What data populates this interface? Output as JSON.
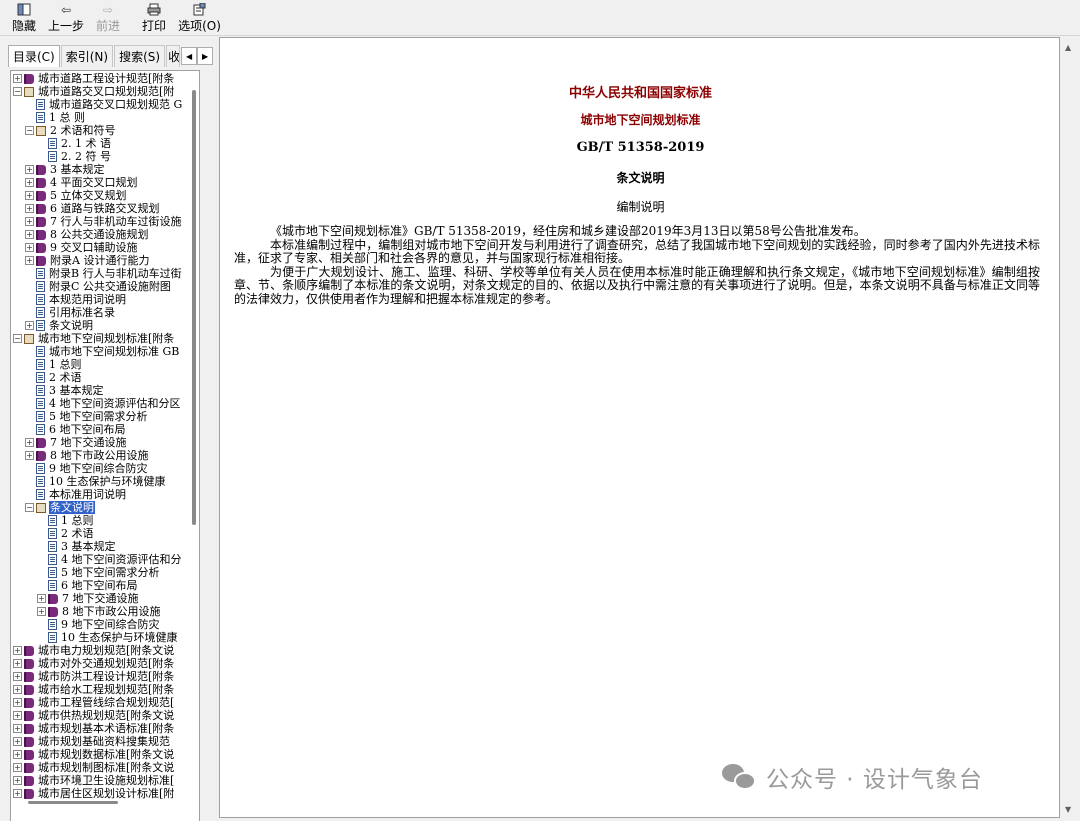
{
  "toolbar": {
    "hide": "隐藏",
    "back": "上一步",
    "forward": "前进",
    "print": "打印",
    "options": "选项(O)"
  },
  "tabs": [
    "目录(C)",
    "索引(N)",
    "搜索(S)",
    "收"
  ],
  "tree": [
    {
      "level": 0,
      "exp": "+",
      "icon": "book-closed",
      "label": "城市道路工程设计规范[附条"
    },
    {
      "level": 0,
      "exp": "-",
      "icon": "book-open",
      "label": "城市道路交叉口规划规范[附"
    },
    {
      "level": 1,
      "exp": "",
      "icon": "page",
      "label": "城市道路交叉口规划规范 G"
    },
    {
      "level": 1,
      "exp": "",
      "icon": "page",
      "label": "1 总 则"
    },
    {
      "level": 1,
      "exp": "-",
      "icon": "book-open",
      "label": "2 术语和符号"
    },
    {
      "level": 2,
      "exp": "",
      "icon": "page",
      "label": "2. 1 术 语"
    },
    {
      "level": 2,
      "exp": "",
      "icon": "page",
      "label": "2. 2 符 号"
    },
    {
      "level": 1,
      "exp": "+",
      "icon": "book-closed",
      "label": "3 基本规定"
    },
    {
      "level": 1,
      "exp": "+",
      "icon": "book-closed",
      "label": "4 平面交叉口规划"
    },
    {
      "level": 1,
      "exp": "+",
      "icon": "book-closed",
      "label": "5 立体交叉规划"
    },
    {
      "level": 1,
      "exp": "+",
      "icon": "book-closed",
      "label": "6 道路与铁路交叉规划"
    },
    {
      "level": 1,
      "exp": "+",
      "icon": "book-closed",
      "label": "7 行人与非机动车过街设施"
    },
    {
      "level": 1,
      "exp": "+",
      "icon": "book-closed",
      "label": "8 公共交通设施规划"
    },
    {
      "level": 1,
      "exp": "+",
      "icon": "book-closed",
      "label": "9 交叉口辅助设施"
    },
    {
      "level": 1,
      "exp": "+",
      "icon": "book-closed",
      "label": "附录A 设计通行能力"
    },
    {
      "level": 1,
      "exp": "",
      "icon": "page",
      "label": "附录B 行人与非机动车过街"
    },
    {
      "level": 1,
      "exp": "",
      "icon": "page",
      "label": "附录C 公共交通设施附图"
    },
    {
      "level": 1,
      "exp": "",
      "icon": "page",
      "label": "本规范用词说明"
    },
    {
      "level": 1,
      "exp": "",
      "icon": "page",
      "label": "引用标准名录"
    },
    {
      "level": 1,
      "exp": "+",
      "icon": "page",
      "label": "条文说明"
    },
    {
      "level": 0,
      "exp": "-",
      "icon": "book-open",
      "label": "城市地下空间规划标准[附条"
    },
    {
      "level": 1,
      "exp": "",
      "icon": "page",
      "label": "城市地下空间规划标准 GB"
    },
    {
      "level": 1,
      "exp": "",
      "icon": "page",
      "label": "1 总则"
    },
    {
      "level": 1,
      "exp": "",
      "icon": "page",
      "label": "2 术语"
    },
    {
      "level": 1,
      "exp": "",
      "icon": "page",
      "label": "3 基本规定"
    },
    {
      "level": 1,
      "exp": "",
      "icon": "page",
      "label": "4 地下空间资源评估和分区"
    },
    {
      "level": 1,
      "exp": "",
      "icon": "page",
      "label": "5 地下空间需求分析"
    },
    {
      "level": 1,
      "exp": "",
      "icon": "page",
      "label": "6 地下空间布局"
    },
    {
      "level": 1,
      "exp": "+",
      "icon": "book-closed",
      "label": "7 地下交通设施"
    },
    {
      "level": 1,
      "exp": "+",
      "icon": "book-closed",
      "label": "8 地下市政公用设施"
    },
    {
      "level": 1,
      "exp": "",
      "icon": "page",
      "label": "9 地下空间综合防灾"
    },
    {
      "level": 1,
      "exp": "",
      "icon": "page",
      "label": "10 生态保护与环境健康"
    },
    {
      "level": 1,
      "exp": "",
      "icon": "page",
      "label": "本标准用词说明"
    },
    {
      "level": 1,
      "exp": "-",
      "icon": "book-open",
      "label": "条文说明",
      "selected": true
    },
    {
      "level": 2,
      "exp": "",
      "icon": "page",
      "label": "1 总则"
    },
    {
      "level": 2,
      "exp": "",
      "icon": "page",
      "label": "2 术语"
    },
    {
      "level": 2,
      "exp": "",
      "icon": "page",
      "label": "3 基本规定"
    },
    {
      "level": 2,
      "exp": "",
      "icon": "page",
      "label": "4 地下空间资源评估和分"
    },
    {
      "level": 2,
      "exp": "",
      "icon": "page",
      "label": "5 地下空间需求分析"
    },
    {
      "level": 2,
      "exp": "",
      "icon": "page",
      "label": "6 地下空间布局"
    },
    {
      "level": 2,
      "exp": "+",
      "icon": "book-closed",
      "label": "7 地下交通设施"
    },
    {
      "level": 2,
      "exp": "+",
      "icon": "book-closed",
      "label": "8 地下市政公用设施"
    },
    {
      "level": 2,
      "exp": "",
      "icon": "page",
      "label": "9 地下空间综合防灾"
    },
    {
      "level": 2,
      "exp": "",
      "icon": "page",
      "label": "10 生态保护与环境健康"
    },
    {
      "level": 0,
      "exp": "+",
      "icon": "book-closed",
      "label": "城市电力规划规范[附条文说"
    },
    {
      "level": 0,
      "exp": "+",
      "icon": "book-closed",
      "label": "城市对外交通规划规范[附条"
    },
    {
      "level": 0,
      "exp": "+",
      "icon": "book-closed",
      "label": "城市防洪工程设计规范[附条"
    },
    {
      "level": 0,
      "exp": "+",
      "icon": "book-closed",
      "label": "城市给水工程规划规范[附条"
    },
    {
      "level": 0,
      "exp": "+",
      "icon": "book-closed",
      "label": "城市工程管线综合规划规范["
    },
    {
      "level": 0,
      "exp": "+",
      "icon": "book-closed",
      "label": "城市供热规划规范[附条文说"
    },
    {
      "level": 0,
      "exp": "+",
      "icon": "book-closed",
      "label": "城市规划基本术语标准[附条"
    },
    {
      "level": 0,
      "exp": "+",
      "icon": "book-closed",
      "label": "城市规划基础资料搜集规范"
    },
    {
      "level": 0,
      "exp": "+",
      "icon": "book-closed",
      "label": "城市规划数据标准[附条文说"
    },
    {
      "level": 0,
      "exp": "+",
      "icon": "book-closed",
      "label": "城市规划制图标准[附条文说"
    },
    {
      "level": 0,
      "exp": "+",
      "icon": "book-closed",
      "label": "城市环境卫生设施规划标准["
    },
    {
      "level": 0,
      "exp": "+",
      "icon": "book-closed",
      "label": "城市居住区规划设计标准[附"
    }
  ],
  "document": {
    "title1": "中华人民共和国国家标准",
    "title2": "城市地下空间规划标准",
    "code": "GB/T 51358-2019",
    "section": "条文说明",
    "subtitle": "编制说明",
    "paragraphs": [
      "《城市地下空间规划标准》GB/T 51358-2019，经住房和城乡建设部2019年3月13日以第58号公告批准发布。",
      "本标准编制过程中，编制组对城市地下空间开发与利用进行了调查研究，总结了我国城市地下空间规划的实践经验，同时参考了国内外先进技术标准，征求了专家、相关部门和社会各界的意见，并与国家现行标准相衔接。",
      "为便于广大规划设计、施工、监理、科研、学校等单位有关人员在使用本标准时能正确理解和执行条文规定，《城市地下空间规划标准》编制组按章、节、条顺序编制了本标准的条文说明，对条文规定的目的、依据以及执行中需注意的有关事项进行了说明。但是，本条文说明不具备与标准正文同等的法律效力，仅供使用者作为理解和把握本标准规定的参考。"
    ]
  },
  "watermark": "公众号 · 设计气象台",
  "colors": {
    "title_red": "#8b0000",
    "selection": "#3162c9"
  }
}
